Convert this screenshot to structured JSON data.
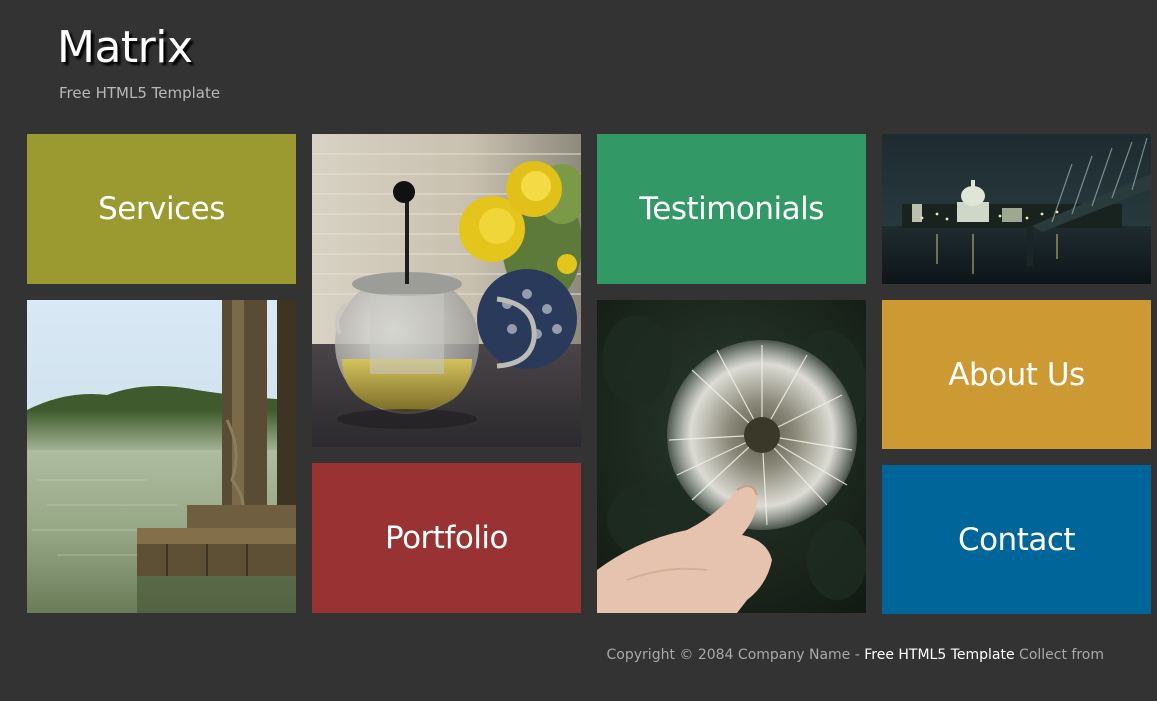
{
  "header": {
    "title": "Matrix",
    "tagline": "Free HTML5 Template"
  },
  "tiles": {
    "services": {
      "label": "Services",
      "color": "#9a9a30"
    },
    "testimonials": {
      "label": "Testimonials",
      "color": "#329966"
    },
    "portfolio": {
      "label": "Portfolio",
      "color": "#993333"
    },
    "about": {
      "label": "About Us",
      "color": "#cc9933"
    },
    "contact": {
      "label": "Contact",
      "color": "#006699"
    }
  },
  "photos": {
    "teapot": "teapot-photo",
    "city": "night-city-photo",
    "lake": "lake-dock-photo",
    "dandelion": "dandelion-photo"
  },
  "footer": {
    "copyright": "Copyright © 2084 Company Name - ",
    "link_text": "Free HTML5 Template",
    "suffix": " Collect from"
  },
  "colors": {
    "background": "#333333"
  }
}
